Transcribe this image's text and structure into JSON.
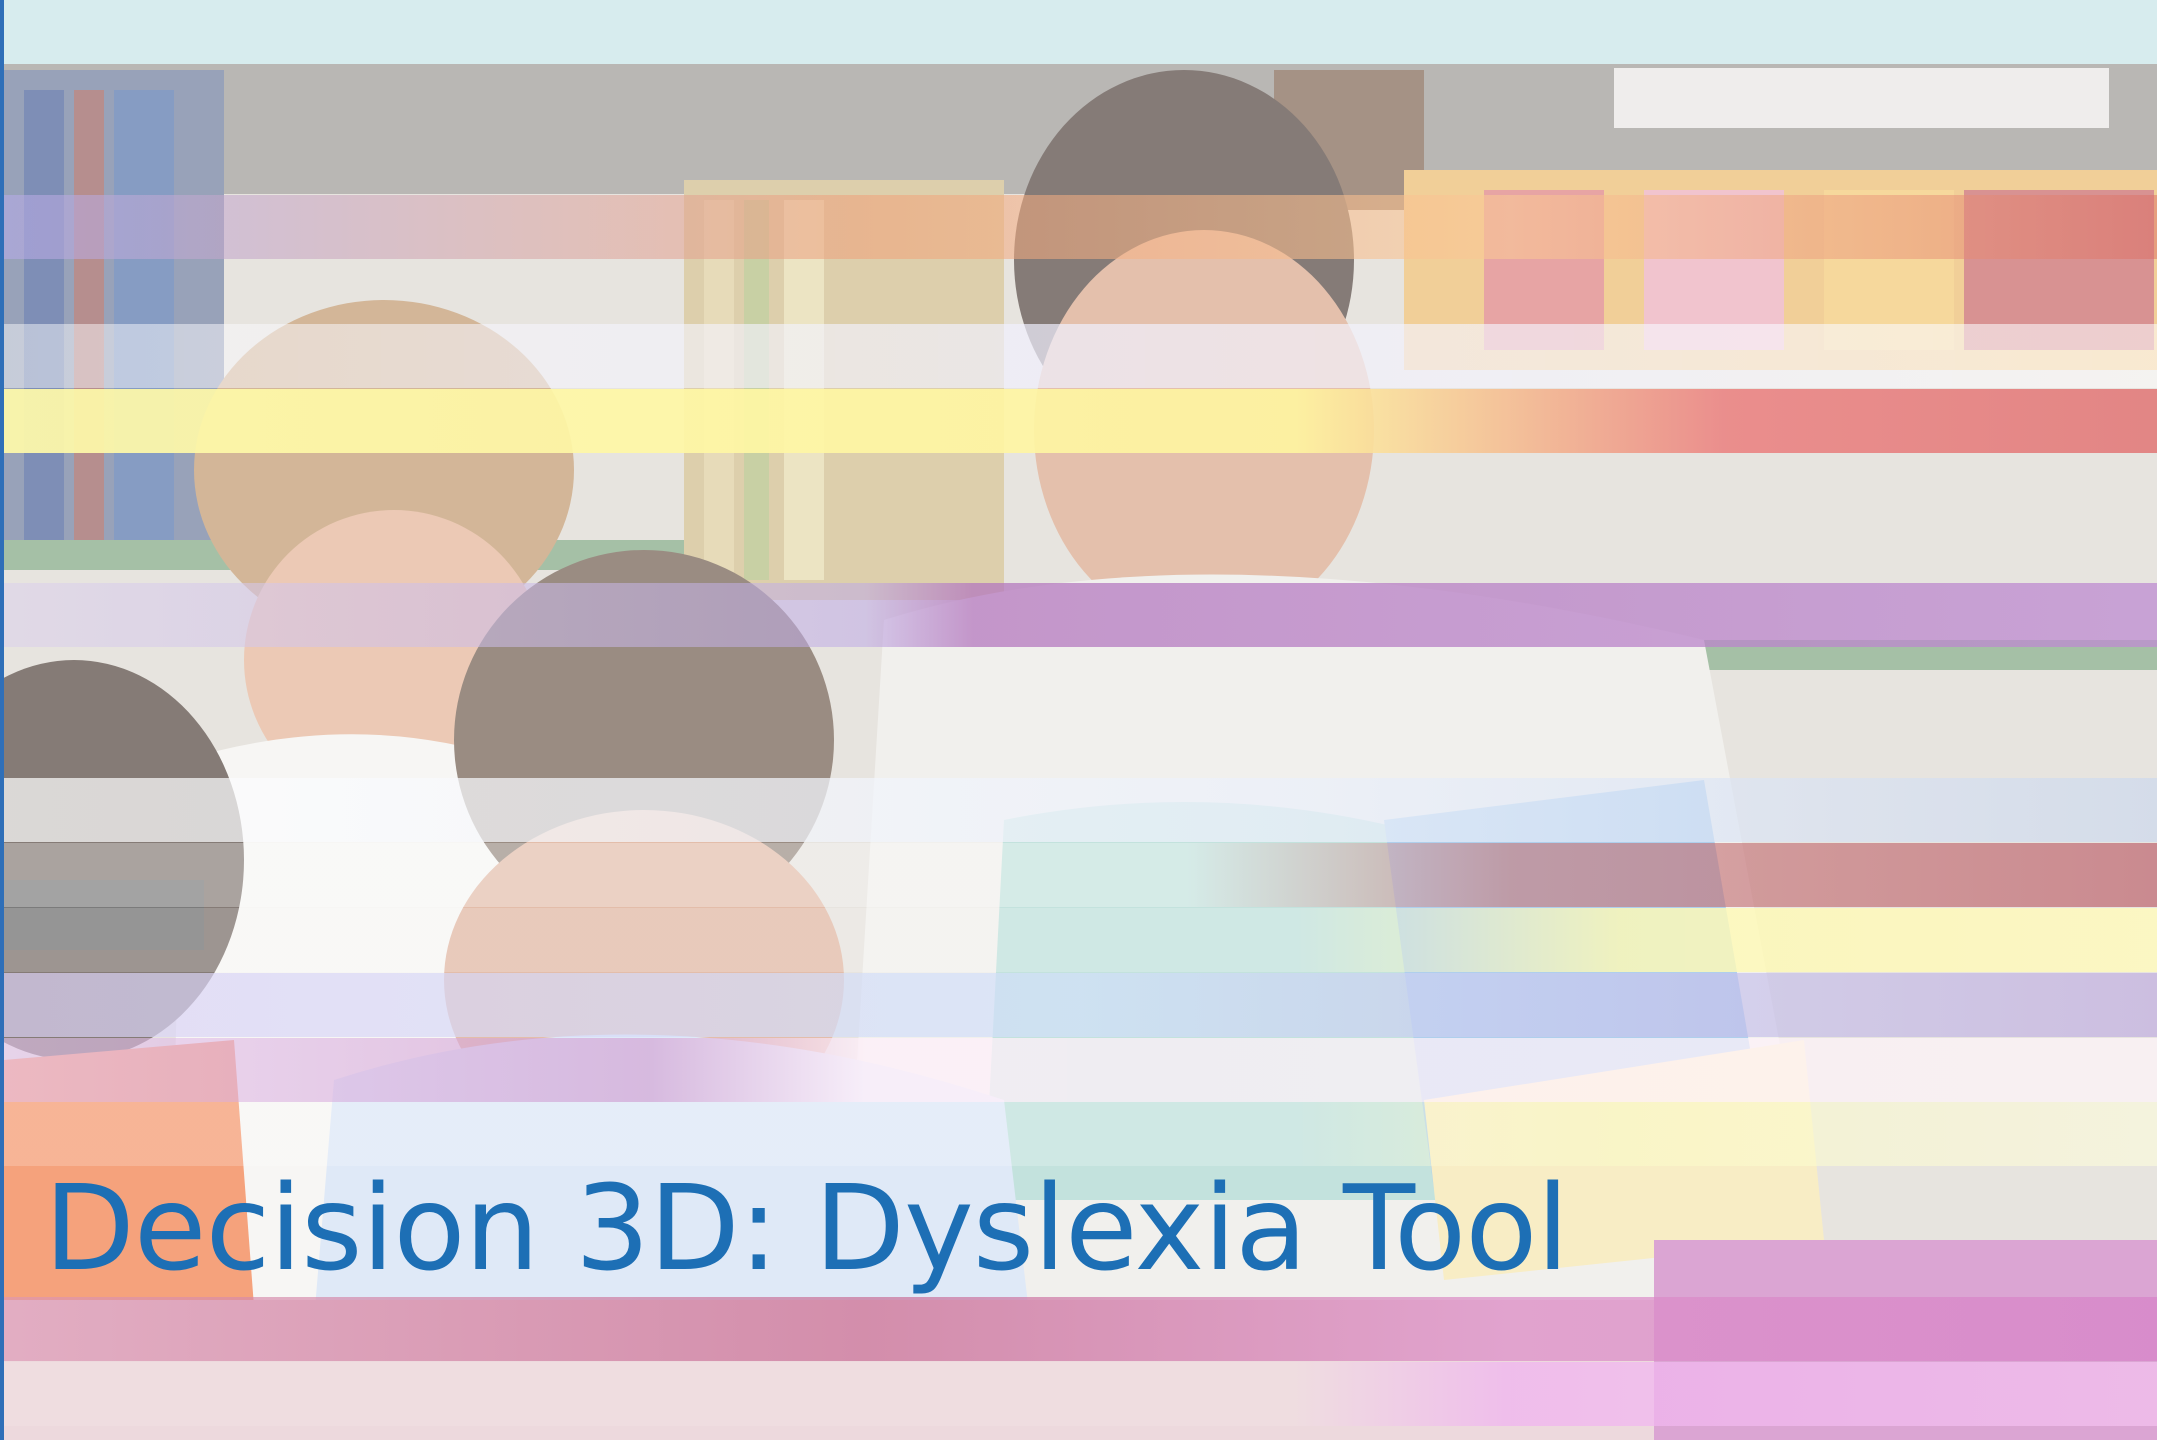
{
  "slide": {
    "title": "Decision 3D: Dyslexia Tool",
    "title_color": "#1d6fb5",
    "left_rule_color": "#2f6fb8"
  }
}
